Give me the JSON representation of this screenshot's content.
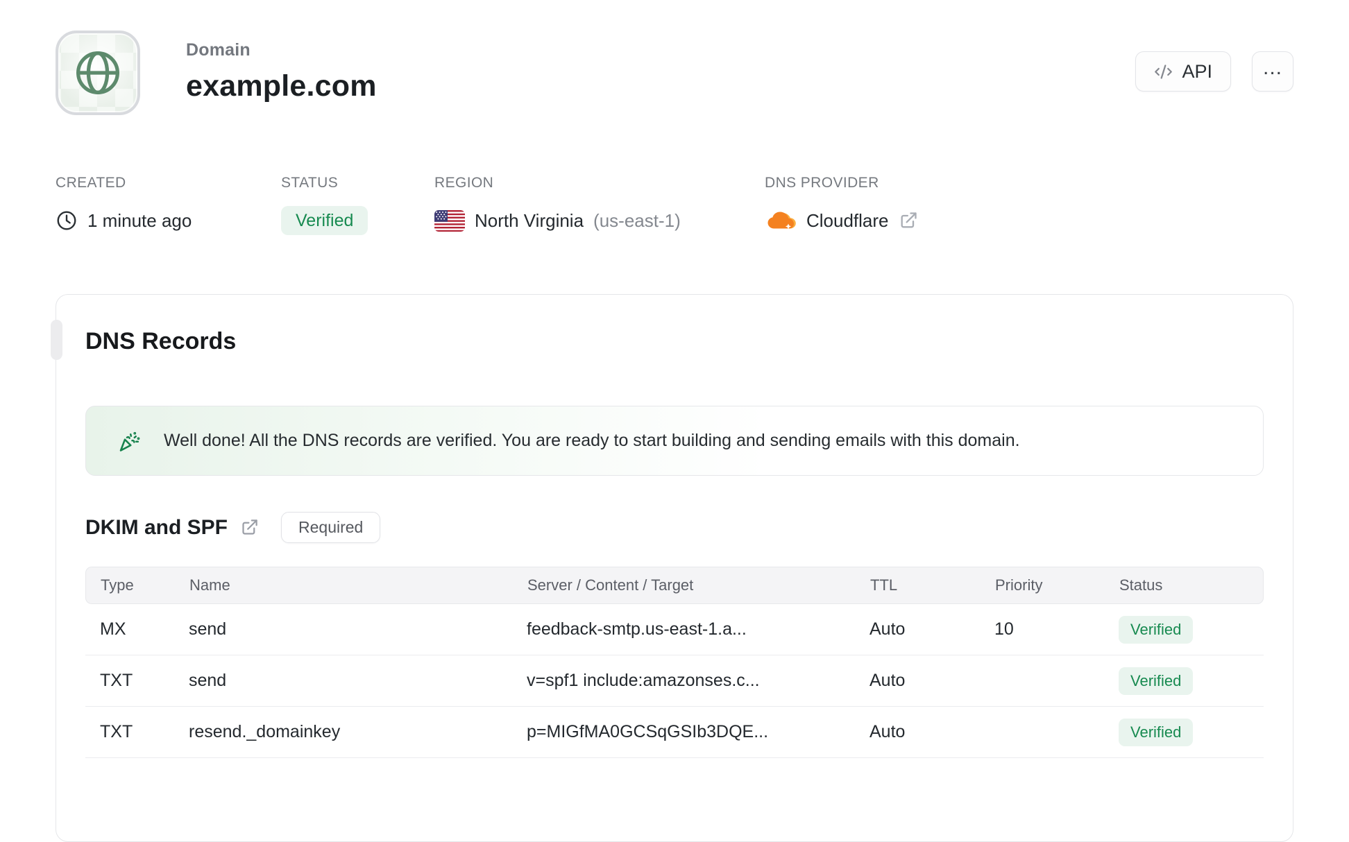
{
  "header": {
    "kicker": "Domain",
    "title": "example.com",
    "api_button_label": "API",
    "menu_button_glyph": "..."
  },
  "meta": {
    "created_label": "CREATED",
    "created_value": "1 minute ago",
    "status_label": "STATUS",
    "status_value": "Verified",
    "region_label": "REGION",
    "region_value": "North Virginia",
    "region_code": "(us-east-1)",
    "dns_provider_label": "DNS PROVIDER",
    "dns_provider_value": "Cloudflare"
  },
  "dns_card": {
    "title": "DNS Records",
    "alert_text": "Well done! All the DNS records are verified. You are ready to start building and sending emails with this domain.",
    "section_title": "DKIM and SPF",
    "required_badge": "Required",
    "table": {
      "headers": [
        "Type",
        "Name",
        "Server / Content / Target",
        "TTL",
        "Priority",
        "Status"
      ],
      "rows": [
        {
          "type": "MX",
          "name": "send",
          "content": "feedback-smtp.us-east-1.a...",
          "ttl": "Auto",
          "priority": "10",
          "status": "Verified"
        },
        {
          "type": "TXT",
          "name": "send",
          "content": "v=spf1 include:amazonses.c...",
          "ttl": "Auto",
          "priority": "",
          "status": "Verified"
        },
        {
          "type": "TXT",
          "name": "resend._domainkey",
          "content": "p=MIGfMA0GCSqGSIb3DQE...",
          "ttl": "Auto",
          "priority": "",
          "status": "Verified"
        }
      ]
    }
  },
  "icons": {
    "globe": "globe",
    "code": "</>",
    "ellipsis": "...",
    "clock": "clock",
    "us_flag": "us-flag",
    "cloudflare": "cloudflare-cloud",
    "external_link": "external-link",
    "confetti": "party-popper"
  },
  "colors": {
    "verified_text": "#178a50",
    "verified_bg": "#e9f4ee",
    "globe_green": "#5d8a6c",
    "alert_green": "#e8f3ea",
    "cloudflare_orange": "#f48120",
    "cloudflare_light": "#faae40",
    "flag_red": "#b22335",
    "flag_blue": "#3d3b74",
    "border": "#e5e6e9",
    "muted_text": "#75797f"
  }
}
